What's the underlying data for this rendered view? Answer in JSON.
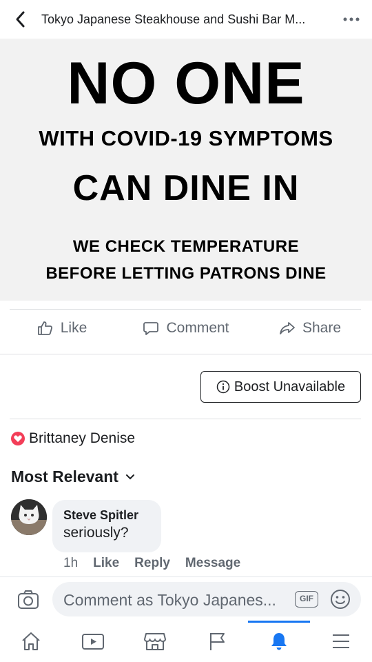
{
  "header": {
    "title": "Tokyo Japanese Steakhouse and Sushi Bar M..."
  },
  "poster": {
    "line1": "NO ONE",
    "line2": "WITH COVID-19 SYMPTOMS",
    "line3": "CAN DINE IN",
    "line4": "WE CHECK TEMPERATURE",
    "line5": "BEFORE LETTING PATRONS DINE"
  },
  "actions": {
    "like": "Like",
    "comment": "Comment",
    "share": "Share"
  },
  "boost": {
    "label": "Boost Unavailable"
  },
  "reaction": {
    "name": "Brittaney Denise"
  },
  "filter": {
    "label": "Most Relevant"
  },
  "comment": {
    "author": "Steve Spitler",
    "text": "seriously?",
    "time": "1h",
    "like": "Like",
    "reply": "Reply",
    "message": "Message"
  },
  "composer": {
    "placeholder": "Comment as Tokyo Japanes...",
    "gif": "GIF"
  },
  "tabs": [
    "home",
    "watch",
    "marketplace",
    "pages",
    "notifications",
    "menu"
  ],
  "colors": {
    "accent": "#1877f2",
    "love": "#f33e58"
  }
}
